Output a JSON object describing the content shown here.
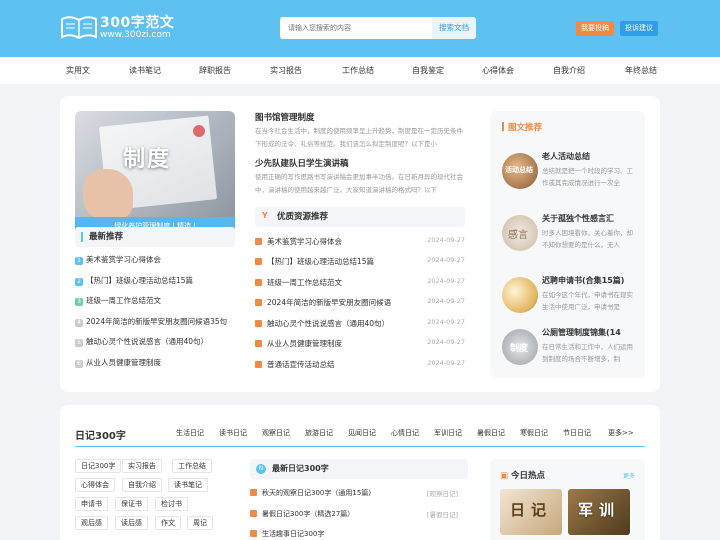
{
  "header": {
    "brand": "300字范文",
    "url": "www.300zi.com",
    "search_placeholder": "请输入您搜索的内容",
    "search_button": "搜索文档",
    "contribute": "我要投稿",
    "feedback": "投诉建议"
  },
  "nav": [
    "实用文",
    "读书笔记",
    "辞职报告",
    "实习报告",
    "工作总结",
    "自我鉴定",
    "心得体会",
    "自我介绍",
    "年终总结"
  ],
  "hero": {
    "chars": "制度",
    "caption": "绿化养护管理制度 | 精选 |"
  },
  "latest": {
    "title": "最新推荐",
    "items": [
      {
        "num": "1",
        "text": "美术鉴赏学习心得体会"
      },
      {
        "num": "2",
        "text": "【热门】班级心理活动总结15篇"
      },
      {
        "num": "3",
        "text": "班级一周工作总结范文"
      },
      {
        "num": "4",
        "text": "2024年简洁的新版早安朋友圈问候语35句"
      },
      {
        "num": "5",
        "text": "触动心灵个性说说感言（通用40句）"
      },
      {
        "num": "6",
        "text": "从业人员健康管理制度"
      }
    ]
  },
  "articles": [
    {
      "title": "图书馆管理制度",
      "desc": "在当今社会生活中，制度的使用频率呈上升趋势，制度是在一定历史条件下形成的法令、礼俗等规范。我们该怎么拟定制度呢？以下是小"
    },
    {
      "title": "少先队建队日学生演讲稿",
      "desc": "使用正确的写作思路书写演讲稿会更加事半功倍。在日新月异的现代社会中，演讲稿的使用越来越广泛，大家知道演讲稿的格式吗？以下"
    }
  ],
  "resources": {
    "title": "优质资源推荐",
    "items": [
      {
        "text": "美术鉴赏学习心得体会",
        "date": "2024-09-27"
      },
      {
        "text": "【热门】班级心理活动总结15篇",
        "date": "2024-09-27"
      },
      {
        "text": "班级一周工作总结范文",
        "date": "2024-09-27"
      },
      {
        "text": "2024年简洁的新版早安朋友圈问候语",
        "date": "2024-09-27"
      },
      {
        "text": "触动心灵个性说说感言（通用40句）",
        "date": "2024-09-27"
      },
      {
        "text": "从业人员健康管理制度",
        "date": "2024-09-27"
      },
      {
        "text": "普通话宣传活动总结",
        "date": "2024-09-27"
      }
    ]
  },
  "featured": {
    "title": "图文推荐",
    "items": [
      {
        "title": "老人活动总结",
        "desc": "总结就是把一个时段的学习、工作或其完成情况进行一次全",
        "thumb": "活动总结"
      },
      {
        "title": "关于孤独个性感言汇",
        "desc": "时多人困境看你，关心着你，却不知你想要的是什么，无人",
        "thumb": "感言"
      },
      {
        "title": "迟聘申请书(合集15篇)",
        "desc": "在如今这个年代，申请书在现实生活中使用广泛，申请书是",
        "thumb": ""
      },
      {
        "title": "公厕管理制度锦集(14",
        "desc": "在日常生活和工作中，人们运用到制度的场合不断增多，制",
        "thumb": "制度"
      }
    ]
  },
  "diary": {
    "title": "日记300字",
    "tabs": [
      "生活日记",
      "读书日记",
      "观察日记",
      "旅游日记",
      "见闻日记",
      "心情日记",
      "军训日记",
      "暑假日记",
      "寒假日记",
      "节日日记",
      "更多>>"
    ],
    "tags": [
      "日记300字",
      "实习报告",
      "工作总结",
      "心得体会",
      "自我介绍",
      "读书笔记",
      "申请书",
      "保证书",
      "检讨书",
      "观后感",
      "读后感",
      "作文",
      "周记"
    ],
    "new_title": "最新日记300字",
    "new_icon": "N",
    "new_items": [
      {
        "text": "秋天的观察日记300字（通用15篇）",
        "cat": "[观察日记]"
      },
      {
        "text": "暑假日记300字（精选27篇）",
        "cat": "[暑假日记]"
      },
      {
        "text": "生活趣事日记300字",
        "cat": ""
      }
    ],
    "hot_title": "今日热点",
    "hot_more": "更多",
    "hot_images": [
      {
        "text": "日记"
      },
      {
        "text": "军训"
      }
    ]
  }
}
